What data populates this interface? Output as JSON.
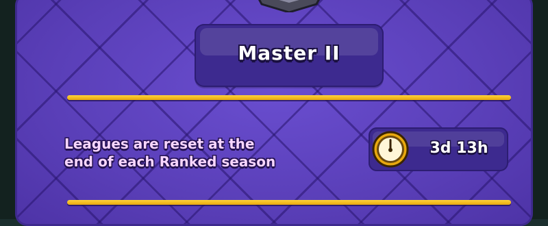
{
  "league": {
    "name": "Master II",
    "badge_icon": "league-badge-icon"
  },
  "reset_info": {
    "text_line1": "Leagues are reset at the",
    "text_line2": "end of each Ranked season"
  },
  "timer": {
    "icon": "clock-icon",
    "value": "3d 13h"
  },
  "colors": {
    "panel": "#5a3fb8",
    "box": "#3d2a8f",
    "divider": "#ffd23a",
    "info_text": "#f7d6ff"
  }
}
